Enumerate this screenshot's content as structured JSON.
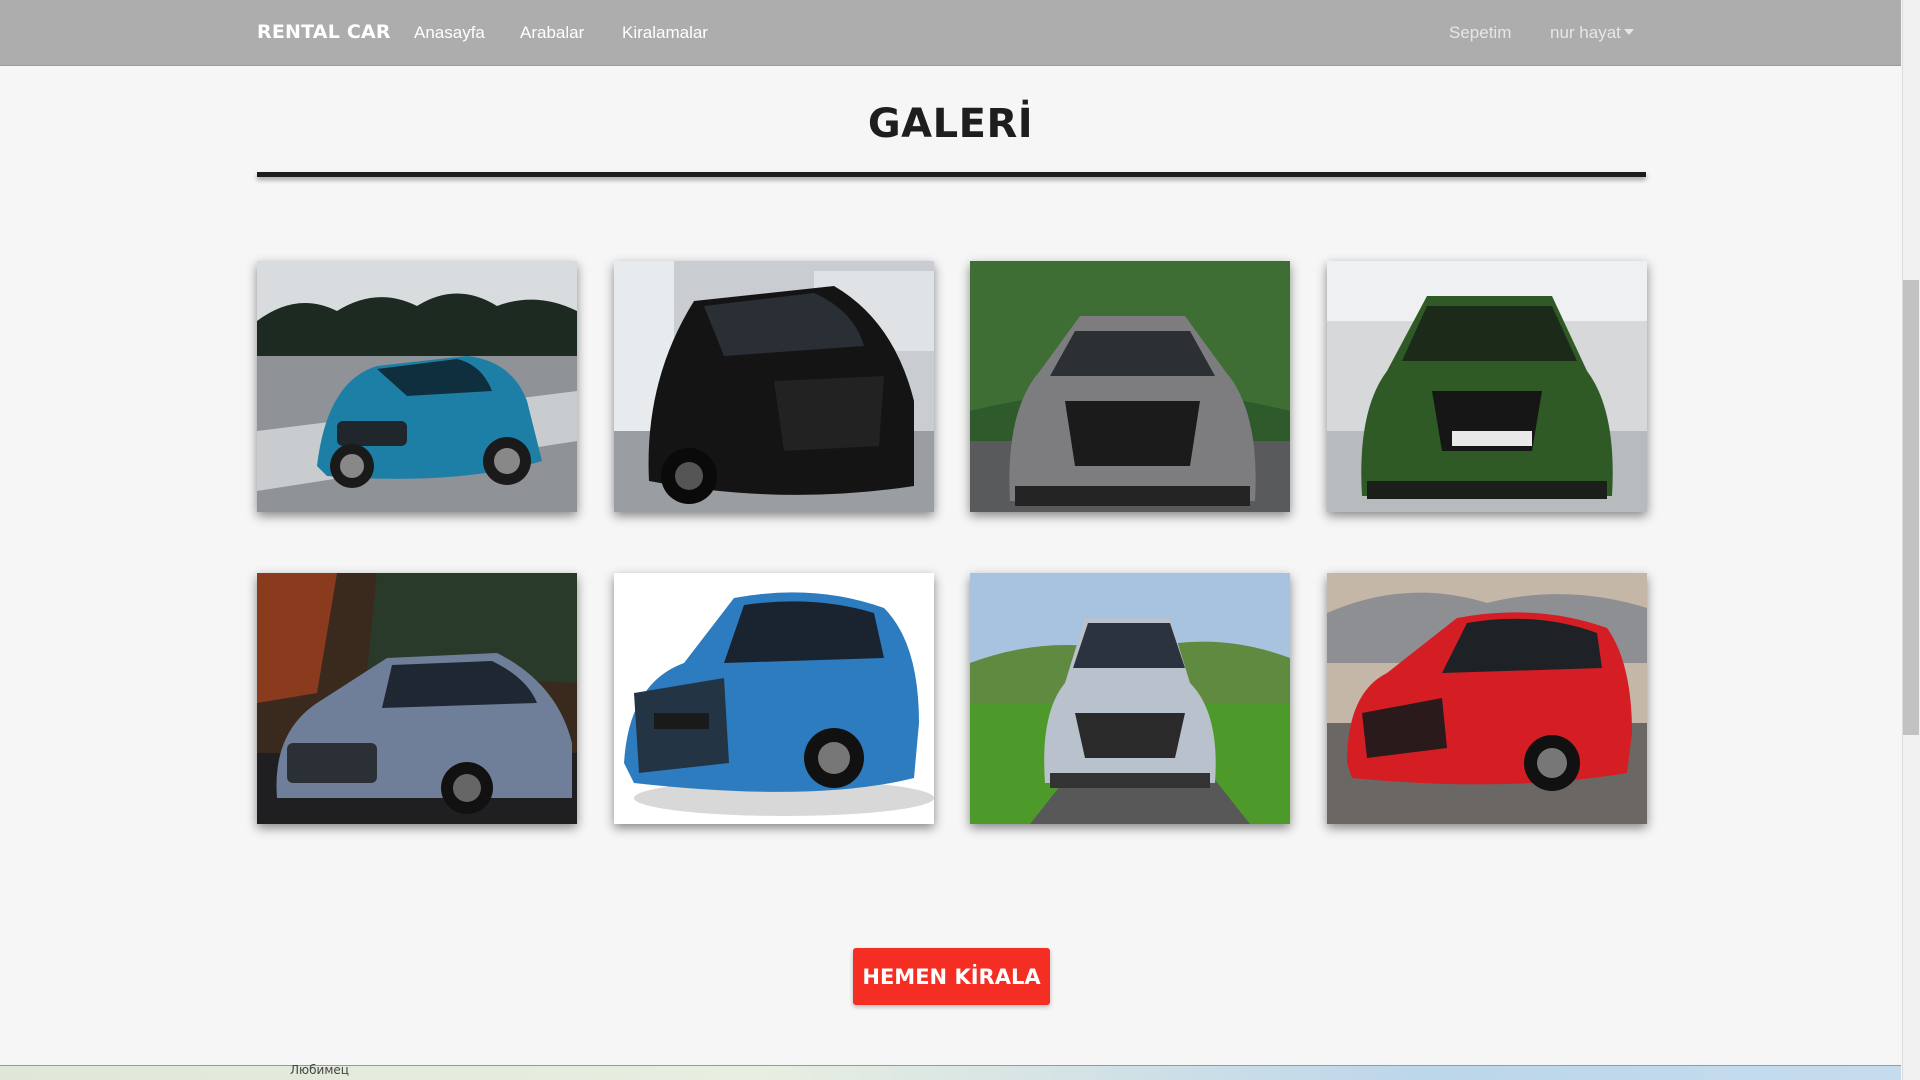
{
  "navbar": {
    "brand": "RENTAL CAR",
    "links": [
      "Anasayfa",
      "Arabalar",
      "Kiralamalar"
    ],
    "cart_label": "Sepetim",
    "user_label": "nur hayat",
    "background": "#adadad"
  },
  "gallery": {
    "title": "GALERİ",
    "cars": [
      {
        "name": "audi-a3-teal",
        "color": "#1d7fa6"
      },
      {
        "name": "audi-a3-black",
        "color": "#141414"
      },
      {
        "name": "audi-rs7-grey",
        "color": "#7d7d80"
      },
      {
        "name": "audi-rs5-green",
        "color": "#2f5a26"
      },
      {
        "name": "audi-prologue-blue",
        "color": "#6f7f99"
      },
      {
        "name": "nissan-qashqai-blue",
        "color": "#2e7cc0"
      },
      {
        "name": "opel-astra-silver",
        "color": "#b9c2cc"
      },
      {
        "name": "opel-corsa-red",
        "color": "#d51d24"
      }
    ]
  },
  "cta": {
    "label": "HEMEN KİRALA",
    "color": "#f52e23"
  },
  "map": {
    "label": "Любимец"
  }
}
